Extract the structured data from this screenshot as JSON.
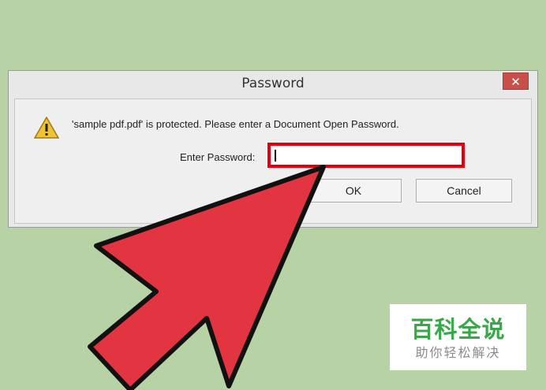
{
  "dialog": {
    "title": "Password",
    "close_label": "✕",
    "message": "'sample pdf.pdf' is protected. Please enter a Document Open Password.",
    "password_label": "Enter Password:",
    "password_value": "",
    "ok_label": "OK",
    "cancel_label": "Cancel",
    "warning_icon": "warning-icon"
  },
  "watermark": {
    "main": "百科全说",
    "sub": "助你轻松解决"
  },
  "colors": {
    "background": "#b7d2a5",
    "highlight": "#e00012",
    "arrow": "#e23441",
    "logo_green": "#3aa64a"
  }
}
